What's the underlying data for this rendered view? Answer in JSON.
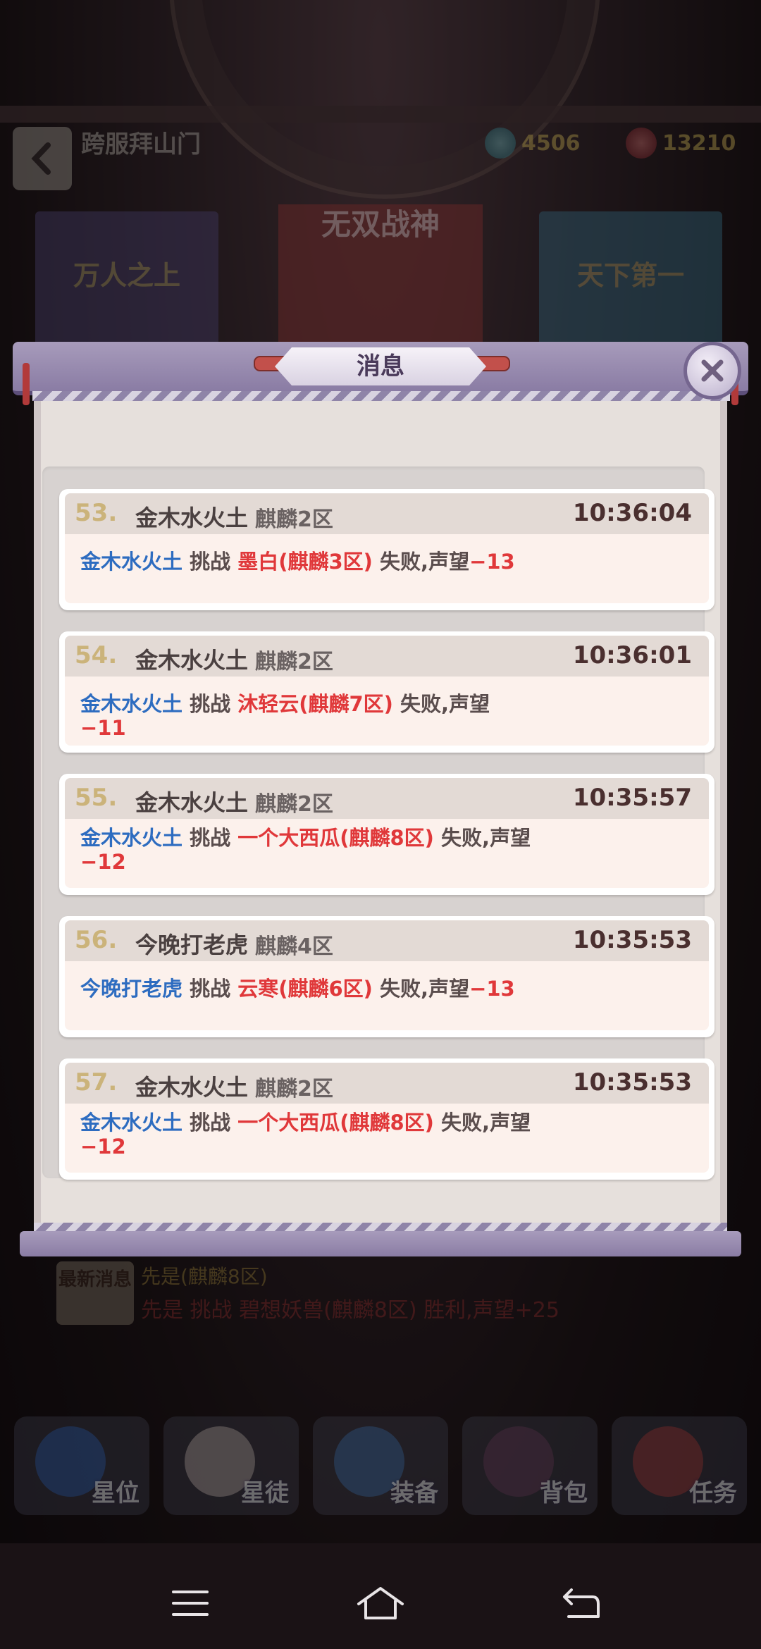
{
  "header": {
    "title": "跨服拜山门",
    "currency": [
      {
        "icon": "crystal-icon",
        "value": "4506"
      },
      {
        "icon": "ruby-icon",
        "value": "13210"
      }
    ]
  },
  "banners": {
    "left": "万人之上",
    "center": "无双战神",
    "right": "天下第一"
  },
  "dialog": {
    "title": "消息",
    "messages": [
      {
        "index": "53.",
        "player": "金木水火土",
        "zone": "麒麟2区",
        "time": "10:36:04",
        "attacker": "金木水火土",
        "verb": "挑战",
        "target": "墨白(麒麟3区)",
        "result": "失败,声望",
        "delta": "−13"
      },
      {
        "index": "54.",
        "player": "金木水火土",
        "zone": "麒麟2区",
        "time": "10:36:01",
        "attacker": "金木水火土",
        "verb": "挑战",
        "target": "沐轻云(麒麟7区)",
        "result": "失败,声望",
        "delta": "−11"
      },
      {
        "index": "55.",
        "player": "金木水火土",
        "zone": "麒麟2区",
        "time": "10:35:57",
        "attacker": "金木水火土",
        "verb": "挑战",
        "target": "一个大西瓜(麒麟8区)",
        "result": "失败,声望",
        "delta": "−12"
      },
      {
        "index": "56.",
        "player": "今晚打老虎",
        "zone": "麒麟4区",
        "time": "10:35:53",
        "attacker": "今晚打老虎",
        "verb": "挑战",
        "target": "云寒(麒麟6区)",
        "result": "失败,声望",
        "delta": "−13"
      },
      {
        "index": "57.",
        "player": "金木水火土",
        "zone": "麒麟2区",
        "time": "10:35:53",
        "attacker": "金木水火土",
        "verb": "挑战",
        "target": "一个大西瓜(麒麟8区)",
        "result": "失败,声望",
        "delta": "−12"
      }
    ]
  },
  "news": {
    "badge": "最新消息",
    "line1": "先是(麒麟8区)",
    "line2": "先是 挑战 碧想妖兽(麒麟8区) 胜利,声望+25"
  },
  "bottom_nav": [
    {
      "label": "星位",
      "icon": "star-orbit-icon"
    },
    {
      "label": "星徒",
      "icon": "pet-icon"
    },
    {
      "label": "装备",
      "icon": "sword-icon"
    },
    {
      "label": "背包",
      "icon": "backpack-icon"
    },
    {
      "label": "任务",
      "icon": "task-scroll-icon"
    }
  ],
  "colors": {
    "player_blue": "#2d6cc0",
    "target_red": "#e0383a",
    "index_gold": "#cbb37a"
  }
}
